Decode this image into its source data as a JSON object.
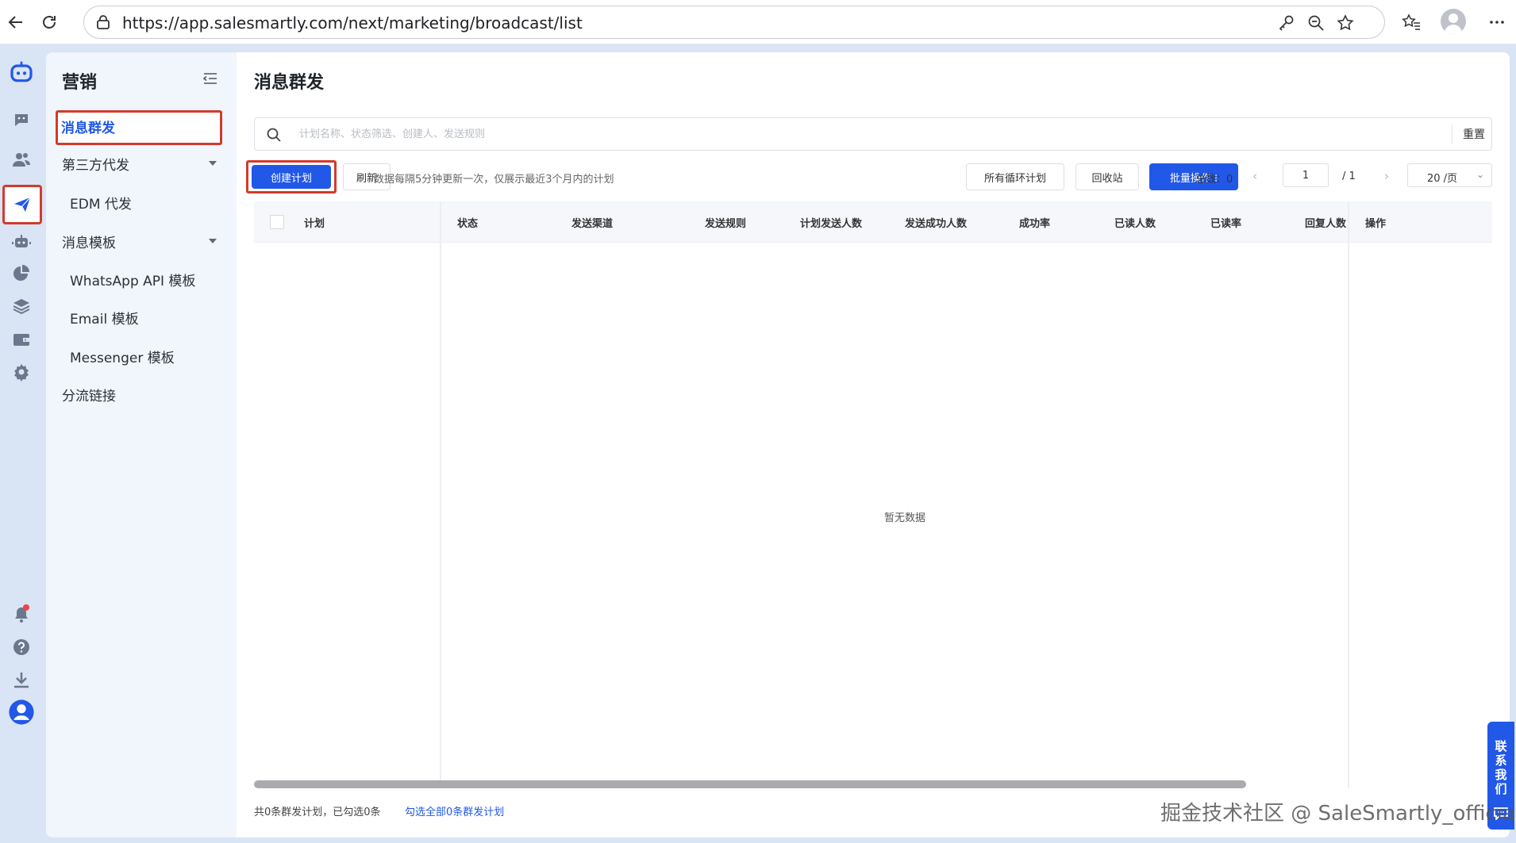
{
  "browser": {
    "url": "https://app.salesmartly.com/next/marketing/broadcast/list"
  },
  "rail": {
    "items": [
      "logo-icon",
      "chat-icon",
      "contacts-icon",
      "marketing-send-icon",
      "bot-icon",
      "analytics-pie-icon",
      "layers-icon",
      "wallet-icon",
      "settings-icon",
      "bell-icon",
      "help-icon",
      "download-icon",
      "user-avatar-icon"
    ],
    "active": "marketing-send-icon"
  },
  "sidebar": {
    "title": "营销",
    "items": [
      {
        "label": "消息群发",
        "active": true
      },
      {
        "label": "第三方代发"
      },
      {
        "label": "EDM 代发"
      },
      {
        "label": "消息模板"
      },
      {
        "label": "WhatsApp API 模板"
      },
      {
        "label": "Email 模板"
      },
      {
        "label": "Messenger 模板"
      },
      {
        "label": "分流链接"
      }
    ]
  },
  "main": {
    "title": "消息群发",
    "search": {
      "placeholder": "计划名称、状态筛选、创建人、发送规则",
      "reset_label": "重置"
    },
    "toolbar": {
      "create_label": "创建计划",
      "refresh_label": "刷新",
      "hint": "数据每隔5分钟更新一次，仅展示最近3个月内的计划",
      "loop_plans_label": "所有循环计划",
      "recycle_label": "回收站",
      "batch_label": "批量操作 ⁝",
      "total_label": "总数：0",
      "page_current": "1",
      "page_total": "/  1",
      "page_size": "20 /页"
    },
    "table": {
      "columns": [
        "计划",
        "状态",
        "发送渠道",
        "发送规则",
        "计划发送人数",
        "发送成功人数",
        "成功率",
        "已读人数",
        "已读率",
        "回复人数",
        "操作"
      ],
      "empty_text": "暂无数据"
    },
    "footer": {
      "summary": "共0条群发计划，已勾选0条",
      "select_all_link": "勾选全部0条群发计划"
    }
  },
  "contact_tab": {
    "label": "联系我们"
  },
  "watermark": "掘金技术社区 @ SaleSmartly_official",
  "colors": {
    "primary": "#2158e8",
    "highlight_border": "#d33a2c",
    "rail_bg": "#d9e4f5",
    "sidebar_bg": "#f1f5fc"
  }
}
